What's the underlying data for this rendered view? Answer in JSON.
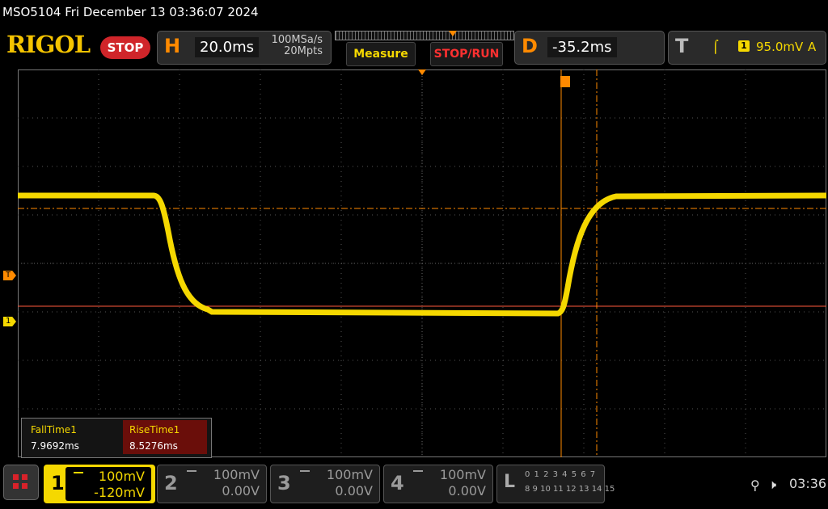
{
  "window": {
    "title": "MSO5104  Fri December 13 03:36:07 2024"
  },
  "header": {
    "logo": "RIGOL",
    "run_state": "STOP",
    "horizontal": {
      "letter": "H",
      "timebase": "20.0ms",
      "sample_rate": "100MSa/s",
      "memory_depth": "20Mpts"
    },
    "measure_label": "Measure",
    "stop_run_label": "STOP/RUN",
    "delay": {
      "letter": "D",
      "value": "-35.2ms"
    },
    "trigger": {
      "letter": "T",
      "edge_icon": "rising-edge-icon",
      "edge_glyph": "⌠",
      "source": "1",
      "level": "95.0mV",
      "mode": "A"
    }
  },
  "markers": {
    "trigger_level": "T",
    "ch1": "1"
  },
  "measurements": [
    {
      "label": "FallTime1",
      "value": "7.9692ms"
    },
    {
      "label": "RiseTime1",
      "value": "8.5276ms"
    }
  ],
  "channels": [
    {
      "num": "1",
      "scale": "100mV",
      "offset": "-120mV",
      "active": true,
      "color": "#f5d800"
    },
    {
      "num": "2",
      "scale": "100mV",
      "offset": "0.00V",
      "active": false
    },
    {
      "num": "3",
      "scale": "100mV",
      "offset": "0.00V",
      "active": false
    },
    {
      "num": "4",
      "scale": "100mV",
      "offset": "0.00V",
      "active": false
    }
  ],
  "logic_analyzer": {
    "letter": "L",
    "row1": "0 1 2 3  4 5 6 7",
    "row2": "8 9 10 11 12 13 14 15"
  },
  "status": {
    "usb_icon": "usb-icon",
    "usb_glyph": "⚲",
    "speaker_icon": "speaker-muted-icon",
    "speaker_glyph": "🕨",
    "time": "03:36"
  },
  "colors": {
    "ch1": "#f5d800",
    "trigger": "#ff8a00",
    "cursor_h": "#ff5a3c",
    "stop": "#d0252a"
  }
}
